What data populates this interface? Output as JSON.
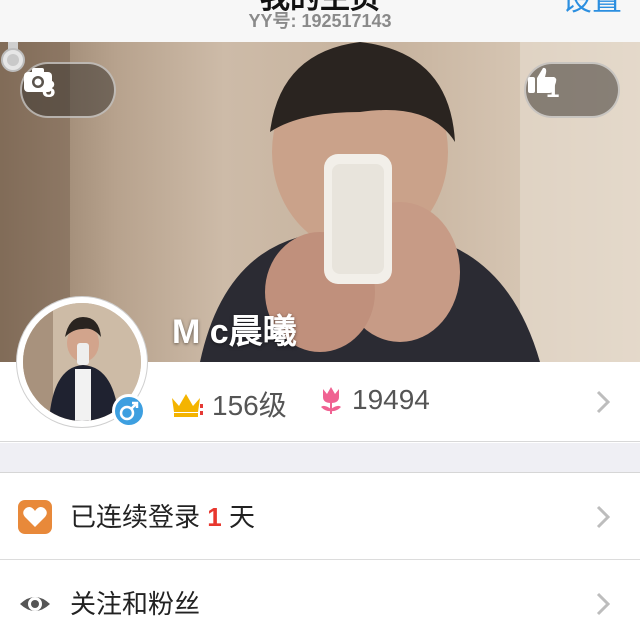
{
  "header": {
    "title": "我的主页",
    "yy_id": "YY号: 192517143",
    "settings_label": "设置"
  },
  "cover": {
    "photo_count": "8",
    "like_count": "1"
  },
  "profile": {
    "username": "M c晨曦",
    "level": "156级",
    "flowers": "19494",
    "gender": "male"
  },
  "menu": {
    "login_prefix": "已连续登录",
    "login_days": "1",
    "login_suffix": "天",
    "follow_label": "关注和粉丝"
  },
  "colors": {
    "accent": "#2c8fe0",
    "login_icon": "#e8893a",
    "highlight_number": "#e8372e",
    "gender_badge": "#3d9fe0"
  }
}
